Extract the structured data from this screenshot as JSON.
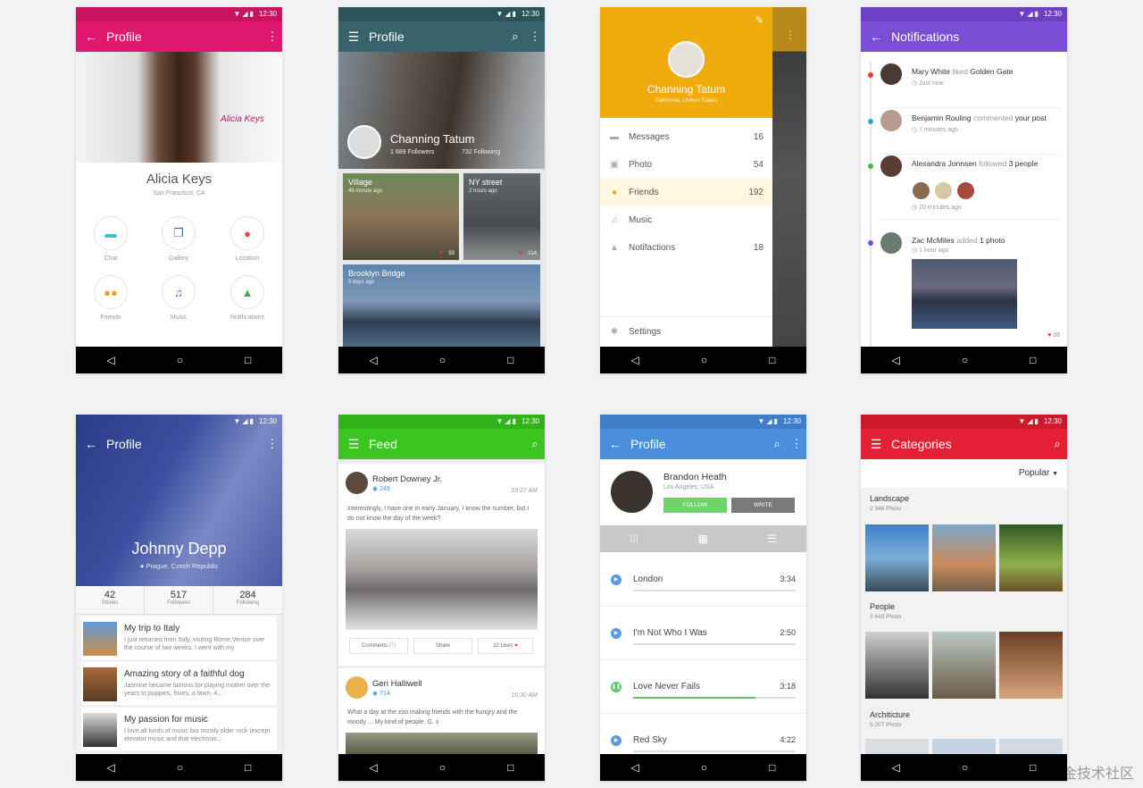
{
  "status": {
    "time": "12:30",
    "icons": "▼◢▮"
  },
  "nav": {
    "back": "◁",
    "home": "○",
    "recent": "□"
  },
  "colors": {
    "pink": "#e01870",
    "teal": "#36646a",
    "amber": "#f0ab0d",
    "purple": "#7a4fd6",
    "indigo": "#3b4fa0",
    "green": "#3ac61e",
    "blue": "#4a8fdc",
    "red": "#e42035"
  },
  "p1": {
    "title": "Profile",
    "name": "Alicia Keys",
    "location": "San Francisco, CA",
    "signature": "Alicia Keys",
    "items": [
      {
        "label": "Chat",
        "icon": "chat-icon",
        "glyph": "▬",
        "color": "#38bdd3"
      },
      {
        "label": "Gallery",
        "icon": "gallery-icon",
        "glyph": "❐",
        "color": "#3c63b0"
      },
      {
        "label": "Location",
        "icon": "location-icon",
        "glyph": "●",
        "color": "#e84b3c"
      },
      {
        "label": "Friends",
        "icon": "friends-icon",
        "glyph": "👥",
        "color": "#f1a22b"
      },
      {
        "label": "Music",
        "icon": "music-icon",
        "glyph": "♫",
        "color": "#7a52c8"
      },
      {
        "label": "Notifications",
        "icon": "bell-icon",
        "glyph": "▲",
        "color": "#36b04a"
      }
    ]
  },
  "p2": {
    "title": "Profile",
    "name": "Channing Tatum",
    "followers": "1 689 Followers",
    "following": "732 Following",
    "tiles": [
      {
        "title": "Village",
        "sub": "46 minute ago",
        "likes": "93"
      },
      {
        "title": "NY street",
        "sub": "2 hours ago",
        "likes": "214"
      },
      {
        "title": "Brooklyn Bridge",
        "sub": "5 days ago"
      }
    ]
  },
  "p3": {
    "name": "Channing Tatum",
    "location": "California, United States",
    "menu": [
      {
        "label": "Messages",
        "count": "16",
        "icon": "message-icon",
        "glyph": "▬"
      },
      {
        "label": "Photo",
        "count": "54",
        "icon": "photo-icon",
        "glyph": "▣"
      },
      {
        "label": "Friends",
        "count": "192",
        "icon": "person-icon",
        "glyph": "●"
      },
      {
        "label": "Music",
        "count": "",
        "icon": "music-icon",
        "glyph": "♫"
      },
      {
        "label": "Notifactions",
        "count": "18",
        "icon": "bell-icon",
        "glyph": "▲"
      }
    ],
    "settings": "Settings"
  },
  "p4": {
    "title": "Notifications",
    "n1": {
      "user": "Mary White",
      "action": "liked",
      "target": "Golden Gate",
      "time": "Just now"
    },
    "n2": {
      "user": "Benjamin Rouling",
      "action": "commented",
      "target": "your post",
      "time": "7 minutes ago"
    },
    "n3": {
      "user": "Alexandra Jonnsen",
      "action": "followed",
      "target": "3 people",
      "time": "20 minutes ago"
    },
    "n4": {
      "user": "Zac McMiles",
      "action": "added",
      "target": "1 photo",
      "time": "1 hour ago",
      "likes": "98"
    }
  },
  "p5": {
    "title": "Profile",
    "name": "Johnny Depp",
    "location": "Prague, Czech Republic",
    "stats": [
      {
        "n": "42",
        "l": "Stories"
      },
      {
        "n": "517",
        "l": "Followers"
      },
      {
        "n": "284",
        "l": "Following"
      }
    ],
    "stories": [
      {
        "t": "My trip to Italy",
        "d": "I just returned from Italy, visiting Rome,Venice over the course of two weeks. I went with my"
      },
      {
        "t": "Amazing story of a faithful dog",
        "d": "Jasmine became famous for playing mother over the years to puppies, foxes, a fawn, 4..."
      },
      {
        "t": "My passion for music",
        "d": "I love all kinds of music but mostly older rock (except elevator music and that electronic..."
      }
    ]
  },
  "p6": {
    "title": "Feed",
    "post1": {
      "name": "Robert Downey Jr.",
      "views": "249",
      "time": "09:27 AM",
      "text": "Interestingly, I have one in early January, I know the number, but I do not know the day of the week?"
    },
    "buttons": {
      "comments": "Comments",
      "comments_n": "(7)",
      "share": "Share",
      "likes": "12 Likes"
    },
    "post2": {
      "name": "Geri Halliwell",
      "views": "714",
      "time": "10:30 AM",
      "text": "What a day at the zoo making friends with the hungry and the moody ... My kind of people. G. x"
    }
  },
  "p7": {
    "title": "Profile",
    "name": "Brandon Heath",
    "location": "Los Angeles, USA",
    "follow": "FOLLOW",
    "write": "WRITE",
    "songs": [
      {
        "name": "London",
        "dur": "3:34",
        "progress": 0,
        "state": "▶"
      },
      {
        "name": "I'm Not Who I Was",
        "dur": "2:50",
        "progress": 0,
        "state": "▶"
      },
      {
        "name": "Love Never Fails",
        "dur": "3:18",
        "progress": 0.75,
        "state": "❚❚"
      },
      {
        "name": "Red Sky",
        "dur": "4:22",
        "progress": 0,
        "state": "▶"
      }
    ]
  },
  "p8": {
    "title": "Categories",
    "sort": "Popular",
    "cats": [
      {
        "name": "Landscape",
        "count": "2 348 Photo"
      },
      {
        "name": "People",
        "count": "3 649 Photo"
      },
      {
        "name": "Architicture",
        "count": "5 207 Photo"
      }
    ]
  },
  "watermark": "@稀土掘金技术社区"
}
